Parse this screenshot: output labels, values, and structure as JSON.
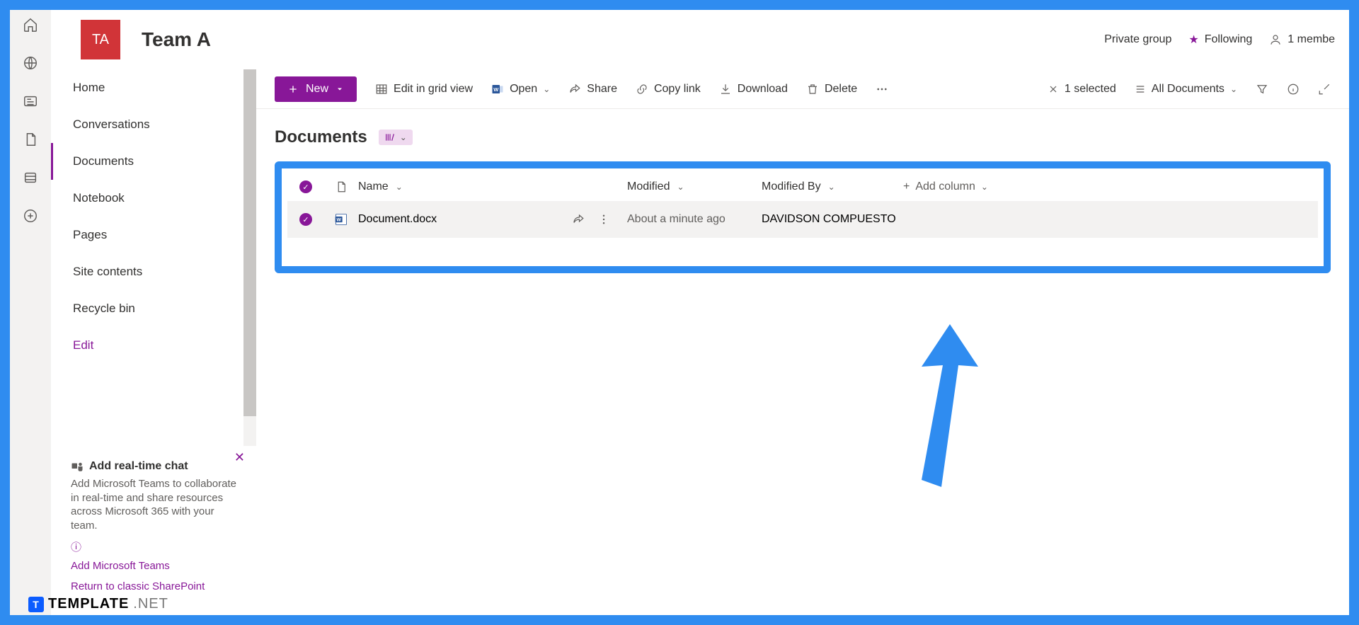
{
  "site": {
    "logo_initials": "TA",
    "title": "Team A"
  },
  "header_right": {
    "privacy": "Private group",
    "following": "Following",
    "members": "1 membe"
  },
  "left_rail_icons": [
    "home",
    "globe",
    "news",
    "file",
    "list",
    "plus"
  ],
  "nav": {
    "items": [
      "Home",
      "Conversations",
      "Documents",
      "Notebook",
      "Pages",
      "Site contents",
      "Recycle bin",
      "Edit"
    ],
    "active_index": 2,
    "edit_index": 7
  },
  "promo": {
    "title": "Add real-time chat",
    "body": "Add Microsoft Teams to collaborate in real-time and share resources across Microsoft 365 with your team.",
    "link": "Add Microsoft Teams",
    "return_link": "Return to classic SharePoint"
  },
  "toolbar": {
    "new": "New",
    "grid": "Edit in grid view",
    "open": "Open",
    "share": "Share",
    "copylink": "Copy link",
    "download": "Download",
    "delete": "Delete",
    "selected": "1 selected",
    "view": "All Documents"
  },
  "page": {
    "title": "Documents"
  },
  "table": {
    "columns": {
      "name": "Name",
      "modified": "Modified",
      "modified_by": "Modified By",
      "add": "Add column"
    },
    "rows": [
      {
        "name": "Document.docx",
        "modified": "About a minute ago",
        "modified_by": "DAVIDSON COMPUESTO"
      }
    ]
  },
  "watermark": {
    "brand": "TEMPLATE",
    "suffix": ".NET",
    "badge": "T"
  }
}
